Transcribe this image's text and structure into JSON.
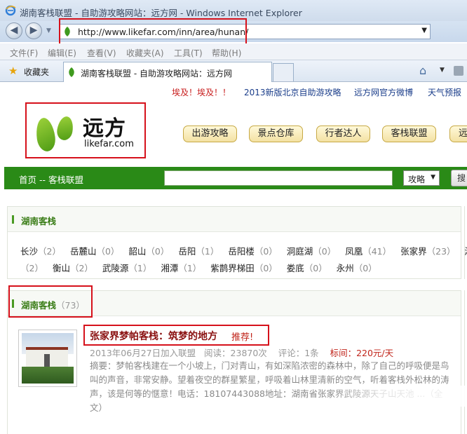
{
  "window": {
    "title": "湖南客栈联盟 - 自助游攻略网站：远方网 - Windows Internet Explorer"
  },
  "address_bar": {
    "url": "http://www.likefar.com/inn/area/hunan/"
  },
  "menu": [
    "文件(F)",
    "编辑(E)",
    "查看(V)",
    "收藏夹(A)",
    "工具(T)",
    "帮助(H)"
  ],
  "favorites": {
    "label": "收藏夹",
    "tab_title": "湖南客栈联盟 - 自助游攻略网站：远方网"
  },
  "top_links": [
    "埃及！埃及！！",
    "2013新版北京自助游攻略",
    "远方网官方微博",
    "天气预报"
  ],
  "logo": {
    "cn": "远方",
    "en": "likefar.com"
  },
  "main_nav": [
    "出游攻略",
    "景点仓库",
    "行者达人",
    "客栈联盟",
    "远"
  ],
  "search": {
    "breadcrumb": "首页 -- 客栈联盟",
    "category": "攻略",
    "button": "搜"
  },
  "regions_panel": {
    "title": "湖南客栈",
    "cities": [
      {
        "name": "长沙",
        "count": "（2）"
      },
      {
        "name": "岳麓山",
        "count": "（0）"
      },
      {
        "name": "韶山",
        "count": "（0）"
      },
      {
        "name": "岳阳",
        "count": "（1）"
      },
      {
        "name": "岳阳楼",
        "count": "（0）"
      },
      {
        "name": "洞庭湖",
        "count": "（0）"
      },
      {
        "name": "凤凰",
        "count": "（41）"
      },
      {
        "name": "张家界",
        "count": "（23）"
      },
      {
        "name": "湘西",
        "count": ""
      },
      {
        "name": "",
        "count": "（2）"
      },
      {
        "name": "衡山",
        "count": "（2）"
      },
      {
        "name": "武陵源",
        "count": "（1）"
      },
      {
        "name": "湘潭",
        "count": "（1）"
      },
      {
        "name": "紫鹊界梯田",
        "count": "（0）"
      },
      {
        "name": "娄底",
        "count": "（0）"
      },
      {
        "name": "永州",
        "count": "（0）"
      }
    ]
  },
  "list_panel": {
    "title": "湖南客栈",
    "count": "（73）"
  },
  "inn": {
    "title": "张家界梦帕客栈：筑梦的地方",
    "tag": "推荐!",
    "joined": "2013年06月27日加入联盟",
    "reads": "阅读：23870次",
    "comments": "评论：1条",
    "price": "标间：220元/天",
    "summary": "摘要：梦帕客栈建在一个小坡上，门对青山，有如深陷浓密的森林中，除了自己的呼吸便是鸟叫的声音，非常安静。望着夜空的群星繁星，呼吸着山林里清新的空气，听着客栈外松林的涛声，该是何等的惬意！电话：18107443088地址：湖南省张家界武陵源天子山天池 ...（全文）"
  }
}
